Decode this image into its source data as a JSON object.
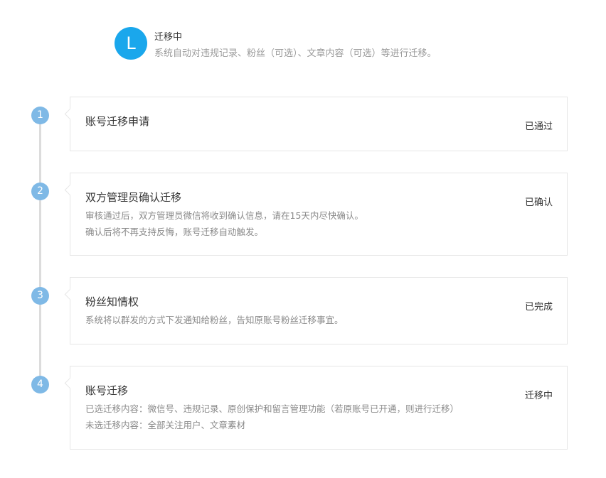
{
  "header": {
    "avatar_letter": "L",
    "title": "迁移中",
    "description": "系统自动对违规记录、粉丝（可选）、文章内容（可选）等进行迁移。"
  },
  "steps": [
    {
      "number": "1",
      "title": "账号迁移申请",
      "status": "已通过",
      "lines": []
    },
    {
      "number": "2",
      "title": "双方管理员确认迁移",
      "status": "已确认",
      "lines": [
        "审核通过后，双方管理员微信将收到确认信息，请在15天内尽快确认。",
        "确认后将不再支持反悔，账号迁移自动触发。"
      ]
    },
    {
      "number": "3",
      "title": "粉丝知情权",
      "status": "已完成",
      "lines": [
        "系统将以群发的方式下发通知给粉丝，告知原账号粉丝迁移事宜。"
      ]
    },
    {
      "number": "4",
      "title": "账号迁移",
      "status": "迁移中",
      "lines": [
        "已选迁移内容：微信号、违规记录、原创保护和留言管理功能（若原账号已开通，则进行迁移）",
        "未选迁移内容：全部关注用户、文章素材"
      ]
    }
  ],
  "colors": {
    "avatar": "#1aa7ec",
    "step_dot": "#7fb9e6",
    "timeline": "#dcdcdc",
    "card_border": "#e6e6e6"
  }
}
